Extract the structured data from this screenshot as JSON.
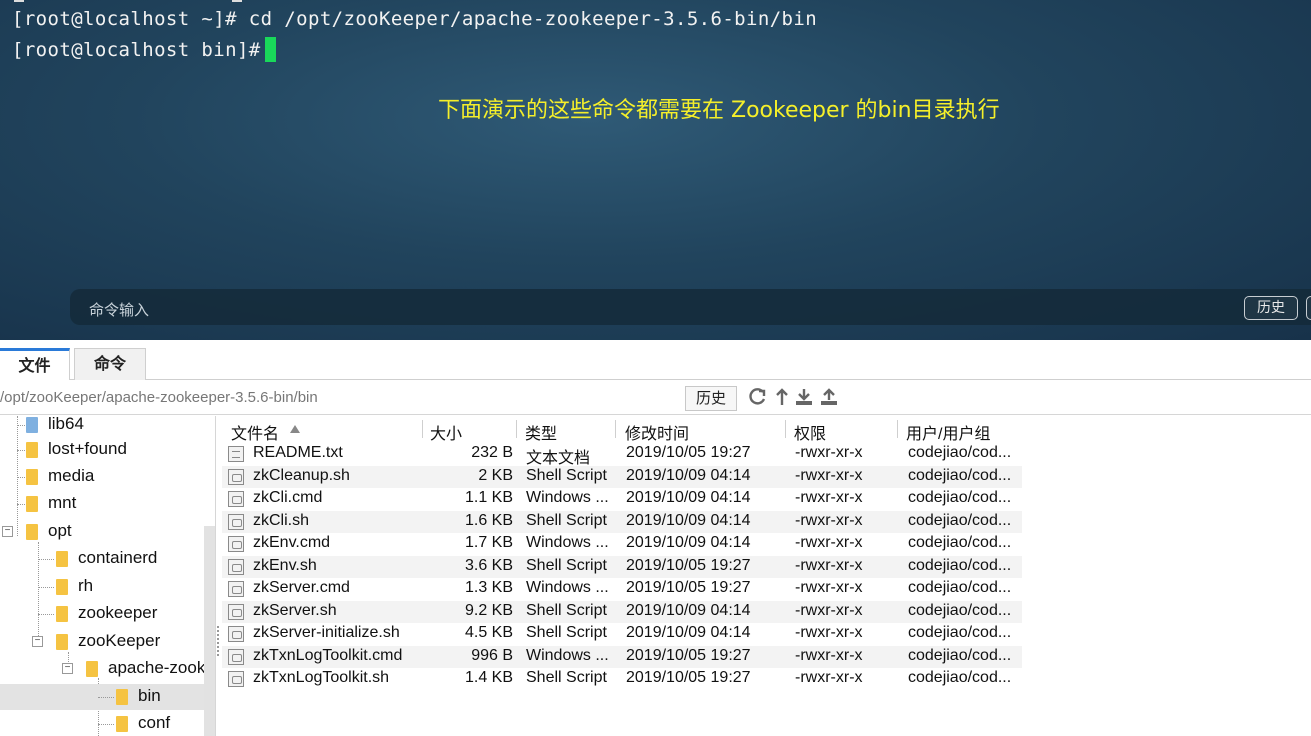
{
  "terminal": {
    "line1": "[root@localhost ~]# cd /opt/zooKeeper/apache-zookeeper-3.5.6-bin/bin",
    "line2": "[root@localhost bin]#",
    "annotation": "下面演示的这些命令都需要在 Zookeeper 的bin目录执行",
    "cursor_color": "#19d85a",
    "annotation_color": "#f5ef2a",
    "command_input_placeholder": "命令输入",
    "history_button": "历史"
  },
  "tabs": [
    {
      "label": "文件",
      "active": true
    },
    {
      "label": "命令",
      "active": false
    }
  ],
  "path_bar": {
    "path": "/opt/zooKeeper/apache-zookeeper-3.5.6-bin/bin",
    "history_button": "历史",
    "icons": [
      "refresh-icon",
      "up-icon",
      "download-icon",
      "upload-icon"
    ]
  },
  "tree": {
    "items": [
      {
        "label": "lib64"
      },
      {
        "label": "lost+found"
      },
      {
        "label": "media"
      },
      {
        "label": "mnt"
      },
      {
        "label": "opt",
        "expanded": true
      },
      {
        "label": "containerd"
      },
      {
        "label": "rh"
      },
      {
        "label": "zookeeper"
      },
      {
        "label": "zooKeeper",
        "expanded": true
      },
      {
        "label": "apache-zook",
        "expanded": true
      },
      {
        "label": "bin",
        "selected": true
      },
      {
        "label": "conf"
      }
    ]
  },
  "file_list": {
    "columns": [
      "文件名",
      "大小",
      "类型",
      "修改时间",
      "权限",
      "用户/用户组"
    ],
    "rows": [
      {
        "name": "README.txt",
        "size": "232 B",
        "type": "文本文档",
        "modified": "2019/10/05 19:27",
        "perm": "-rwxr-xr-x",
        "owner": "codejiao/cod..."
      },
      {
        "name": "zkCleanup.sh",
        "size": "2 KB",
        "type": "Shell Script",
        "modified": "2019/10/09 04:14",
        "perm": "-rwxr-xr-x",
        "owner": "codejiao/cod..."
      },
      {
        "name": "zkCli.cmd",
        "size": "1.1 KB",
        "type": "Windows ...",
        "modified": "2019/10/09 04:14",
        "perm": "-rwxr-xr-x",
        "owner": "codejiao/cod..."
      },
      {
        "name": "zkCli.sh",
        "size": "1.6 KB",
        "type": "Shell Script",
        "modified": "2019/10/09 04:14",
        "perm": "-rwxr-xr-x",
        "owner": "codejiao/cod..."
      },
      {
        "name": "zkEnv.cmd",
        "size": "1.7 KB",
        "type": "Windows ...",
        "modified": "2019/10/09 04:14",
        "perm": "-rwxr-xr-x",
        "owner": "codejiao/cod..."
      },
      {
        "name": "zkEnv.sh",
        "size": "3.6 KB",
        "type": "Shell Script",
        "modified": "2019/10/05 19:27",
        "perm": "-rwxr-xr-x",
        "owner": "codejiao/cod..."
      },
      {
        "name": "zkServer.cmd",
        "size": "1.3 KB",
        "type": "Windows ...",
        "modified": "2019/10/05 19:27",
        "perm": "-rwxr-xr-x",
        "owner": "codejiao/cod..."
      },
      {
        "name": "zkServer.sh",
        "size": "9.2 KB",
        "type": "Shell Script",
        "modified": "2019/10/09 04:14",
        "perm": "-rwxr-xr-x",
        "owner": "codejiao/cod..."
      },
      {
        "name": "zkServer-initialize.sh",
        "size": "4.5 KB",
        "type": "Shell Script",
        "modified": "2019/10/09 04:14",
        "perm": "-rwxr-xr-x",
        "owner": "codejiao/cod..."
      },
      {
        "name": "zkTxnLogToolkit.cmd",
        "size": "996 B",
        "type": "Windows ...",
        "modified": "2019/10/05 19:27",
        "perm": "-rwxr-xr-x",
        "owner": "codejiao/cod..."
      },
      {
        "name": "zkTxnLogToolkit.sh",
        "size": "1.4 KB",
        "type": "Shell Script",
        "modified": "2019/10/05 19:27",
        "perm": "-rwxr-xr-x",
        "owner": "codejiao/cod..."
      }
    ]
  }
}
